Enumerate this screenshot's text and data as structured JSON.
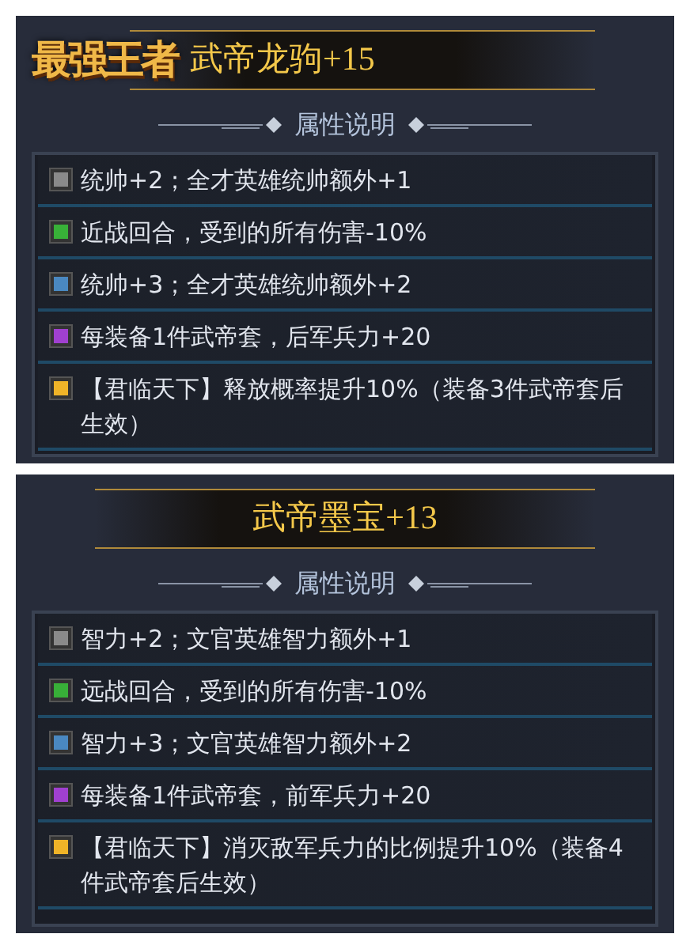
{
  "panels": [
    {
      "logo": "最强王者",
      "title": "武帝龙驹+15",
      "section": "属性说明",
      "attributes": [
        {
          "color": "#8a8a8a",
          "text": "统帅+2；全才英雄统帅额外+1"
        },
        {
          "color": "#38b038",
          "text": "近战回合，受到的所有伤害-10%"
        },
        {
          "color": "#4a88c0",
          "text": "统帅+3；全才英雄统帅额外+2"
        },
        {
          "color": "#a040d0",
          "text": "每装备1件武帝套，后军兵力+20"
        },
        {
          "color": "#f0b428",
          "text": "【君临天下】释放概率提升10%（装备3件武帝套后生效）"
        }
      ]
    },
    {
      "title": "武帝墨宝+13",
      "section": "属性说明",
      "attributes": [
        {
          "color": "#8a8a8a",
          "text": "智力+2；文官英雄智力额外+1"
        },
        {
          "color": "#38b038",
          "text": "远战回合，受到的所有伤害-10%"
        },
        {
          "color": "#4a88c0",
          "text": "智力+3；文官英雄智力额外+2"
        },
        {
          "color": "#a040d0",
          "text": "每装备1件武帝套，前军兵力+20"
        },
        {
          "color": "#f0b428",
          "text": "【君临天下】消灭敌军兵力的比例提升10%（装备4件武帝套后生效）"
        }
      ]
    }
  ]
}
